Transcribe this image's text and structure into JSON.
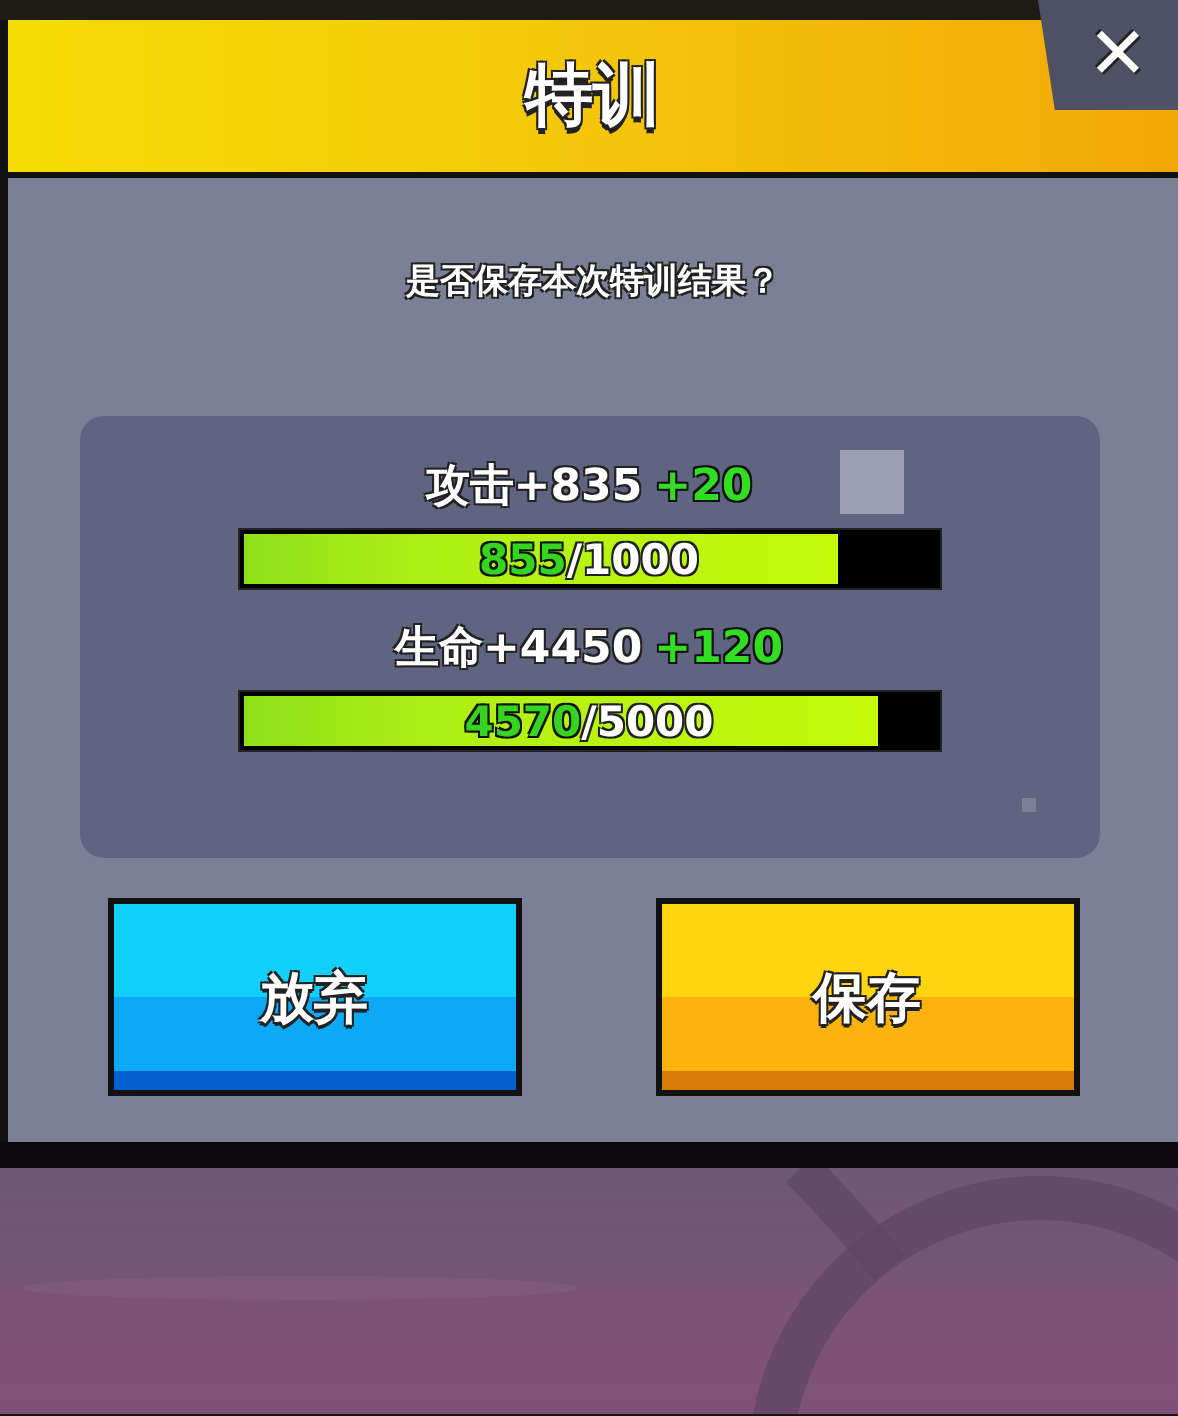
{
  "dialog": {
    "title": "特训",
    "close": "✕",
    "question": "是否保存本次特训结果？"
  },
  "stats": [
    {
      "label": "攻击+835",
      "bonus": "+20",
      "current": "855",
      "rest": "/1000",
      "level": 0.85
    },
    {
      "label": "生命+4450",
      "bonus": "+120",
      "current": "4570",
      "rest": "/5000",
      "level": 0.906
    }
  ],
  "buttons": [
    {
      "label": "放弃",
      "kind": "cancel"
    },
    {
      "label": "保存",
      "kind": "confirm"
    }
  ]
}
